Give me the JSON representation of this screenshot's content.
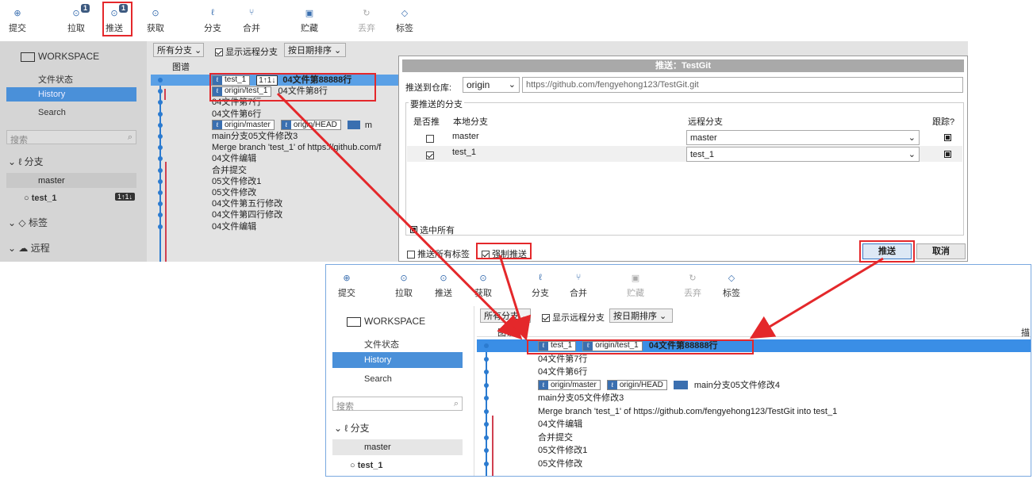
{
  "top": {
    "toolbar": [
      {
        "label": "提交",
        "icon": "commit-icon",
        "disabled": false
      },
      {
        "label": "拉取",
        "icon": "pull-icon",
        "disabled": false,
        "badge": "1"
      },
      {
        "label": "推送",
        "icon": "push-icon",
        "disabled": false,
        "badge": "1"
      },
      {
        "label": "获取",
        "icon": "fetch-icon",
        "disabled": false
      },
      {
        "label": "分支",
        "icon": "branch-icon",
        "disabled": false
      },
      {
        "label": "合并",
        "icon": "merge-icon",
        "disabled": false
      },
      {
        "label": "贮藏",
        "icon": "stash-icon",
        "disabled": false
      },
      {
        "label": "丢弃",
        "icon": "discard-icon",
        "disabled": true
      },
      {
        "label": "标签",
        "icon": "tag-icon",
        "disabled": false
      }
    ],
    "filter_all_branches": "所有分支",
    "show_remote": "显示远程分支",
    "sort_by_date": "按日期排序",
    "graph_header": "图谱",
    "sidebar": {
      "workspace": "WORKSPACE",
      "file_status": "文件状态",
      "history": "History",
      "search": "Search",
      "search_placeholder": "搜索",
      "branches": "分支",
      "master": "master",
      "test_1": "test_1",
      "test_1_badge": "1↑1↓",
      "tags": "标签",
      "remotes": "远程"
    },
    "commits": [
      {
        "tag1": "test_1",
        "tag1b": "1↑1↓",
        "text": "04文件第88888行"
      },
      {
        "tag1": "origin/test_1",
        "text": "04文件第8行"
      },
      {
        "text": "04文件第7行"
      },
      {
        "text": "04文件第6行"
      },
      {
        "tag1": "origin/master",
        "tag2": "origin/HEAD",
        "tag3": "m",
        "text": ""
      },
      {
        "text": "main分支05文件修改3"
      },
      {
        "text": "Merge branch 'test_1' of https://github.com/f"
      },
      {
        "text": "04文件编辑"
      },
      {
        "text": "合并提交"
      },
      {
        "text": "05文件修改1"
      },
      {
        "text": "05文件修改"
      },
      {
        "text": "04文件第五行修改"
      },
      {
        "text": "04文件第四行修改"
      },
      {
        "text": "04文件编辑"
      }
    ]
  },
  "dialog": {
    "title": "推送：TestGit",
    "push_to_repo_label": "推送到仓库:",
    "remote": "origin",
    "remote_url": "https://github.com/fengyehong123/TestGit.git",
    "branches_group": "要推送的分支",
    "col_push": "是否推",
    "col_local": "本地分支",
    "col_remote": "远程分支",
    "col_track": "跟踪?",
    "rows": [
      {
        "checked": false,
        "local": "master",
        "remote": "master"
      },
      {
        "checked": true,
        "local": "test_1",
        "remote": "test_1"
      }
    ],
    "select_all": "选中所有",
    "push_all_tags": "推送所有标签",
    "force_push": "强制推送",
    "ok": "推送",
    "cancel": "取消"
  },
  "bottom": {
    "toolbar": [
      {
        "label": "提交",
        "icon": "commit-icon",
        "disabled": false
      },
      {
        "label": "拉取",
        "icon": "pull-icon",
        "disabled": false
      },
      {
        "label": "推送",
        "icon": "push-icon",
        "disabled": false
      },
      {
        "label": "获取",
        "icon": "fetch-icon",
        "disabled": false
      },
      {
        "label": "分支",
        "icon": "branch-icon",
        "disabled": false
      },
      {
        "label": "合并",
        "icon": "merge-icon",
        "disabled": false
      },
      {
        "label": "贮藏",
        "icon": "stash-icon",
        "disabled": true
      },
      {
        "label": "丢弃",
        "icon": "discard-icon",
        "disabled": true
      },
      {
        "label": "标签",
        "icon": "tag-icon",
        "disabled": false
      }
    ],
    "filter_all_branches": "所有分支",
    "show_remote": "显示远程分支",
    "sort_by_date": "按日期排序",
    "graph_header": "图谱",
    "desc_header": "描述",
    "sidebar": {
      "workspace": "WORKSPACE",
      "file_status": "文件状态",
      "history": "History",
      "search": "Search",
      "search_placeholder": "搜索",
      "branches": "分支",
      "master": "master",
      "test_1": "test_1"
    },
    "commits": [
      {
        "tag1": "test_1",
        "tag2": "origin/test_1",
        "text": "04文件第88888行"
      },
      {
        "text": "04文件第7行"
      },
      {
        "text": "04文件第6行"
      },
      {
        "tag1": "origin/master",
        "tag2": "origin/HEAD",
        "tag3": "",
        "text": "main分支05文件修改4"
      },
      {
        "text": "main分支05文件修改3"
      },
      {
        "text": "Merge branch 'test_1' of https://github.com/fengyehong123/TestGit into test_1"
      },
      {
        "text": "04文件编辑"
      },
      {
        "text": "合并提交"
      },
      {
        "text": "05文件修改1"
      },
      {
        "text": "05文件修改"
      }
    ]
  }
}
